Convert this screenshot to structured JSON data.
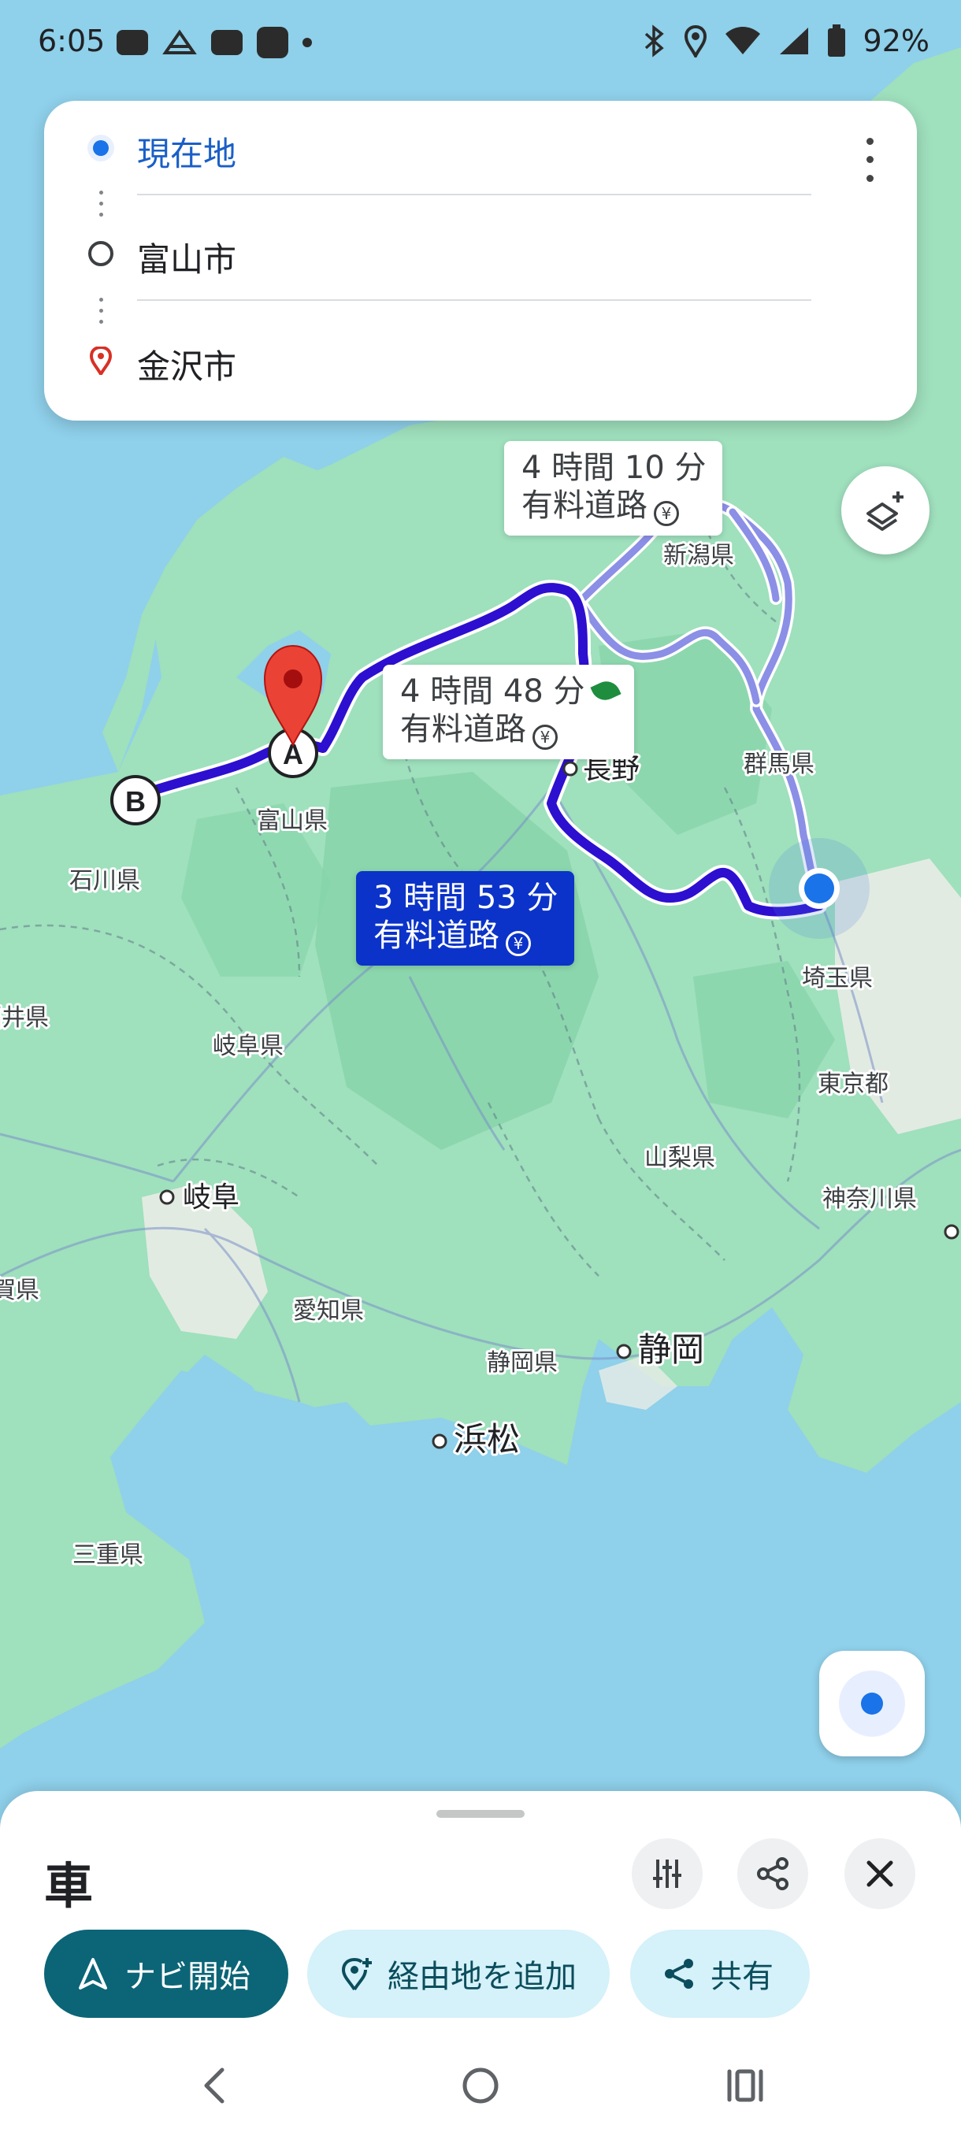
{
  "status_bar": {
    "time": "6:05",
    "battery_percent": "92%",
    "left_icons": [
      "youtube-icon",
      "drive-icon",
      "youtube-icon",
      "app-icon",
      "notification-dot"
    ],
    "right_icons": [
      "bluetooth-icon",
      "location-icon",
      "wifi-icon",
      "signal-icon",
      "battery-icon"
    ]
  },
  "route": {
    "origin": "現在地",
    "waypoint": "富山市",
    "destination": "金沢市"
  },
  "route_options": [
    {
      "id": "alt-a",
      "time": "4 時間 10 分",
      "note": "有料道路",
      "selected": false,
      "eco": false
    },
    {
      "id": "alt-b",
      "time": "4 時間 48 分",
      "note": "有料道路",
      "selected": false,
      "eco": true
    },
    {
      "id": "best",
      "time": "3 時間 53 分",
      "note": "有料道路",
      "selected": true,
      "eco": false
    }
  ],
  "map": {
    "place_labels": [
      {
        "key": "niigata",
        "text": "新潟県"
      },
      {
        "key": "nagano",
        "text": "長野"
      },
      {
        "key": "gunma",
        "text": "群馬県"
      },
      {
        "key": "toyama",
        "text": "富山県"
      },
      {
        "key": "ishikawa",
        "text": "石川県"
      },
      {
        "key": "saitama",
        "text": "埼玉県"
      },
      {
        "key": "fukui",
        "text": "福井県"
      },
      {
        "key": "gifu_pref",
        "text": "岐阜県"
      },
      {
        "key": "tokyo",
        "text": "東京都"
      },
      {
        "key": "yamanashi",
        "text": "山梨県"
      },
      {
        "key": "gifu_city",
        "text": "岐阜"
      },
      {
        "key": "kanagawa",
        "text": "神奈川県"
      },
      {
        "key": "shiga",
        "text": "滋賀県"
      },
      {
        "key": "aichi",
        "text": "愛知県"
      },
      {
        "key": "shizuoka_pref",
        "text": "静岡県"
      },
      {
        "key": "shizuoka_city",
        "text": "静岡"
      },
      {
        "key": "hamamatsu",
        "text": "浜松"
      },
      {
        "key": "mie",
        "text": "三重県"
      }
    ],
    "stop_markers": {
      "a": "A",
      "b": "B"
    },
    "colors": {
      "water": "#8fd0ea",
      "land": "#9fe0bd",
      "land_dark": "#86d3a9",
      "urban": "#e9ece6",
      "route_primary": "#2d0fd0",
      "route_alt": "#8c8fe6",
      "current_location": "#1a73e8",
      "pin": "#ea4335"
    }
  },
  "bottom_sheet": {
    "mode": "車",
    "start_label": "ナビ開始",
    "add_waypoint_label": "経由地を追加",
    "share_label": "共有",
    "icons": [
      "tune-icon",
      "share-icon",
      "close-icon"
    ]
  },
  "system_nav": [
    "back-icon",
    "home-icon",
    "recents-icon"
  ]
}
